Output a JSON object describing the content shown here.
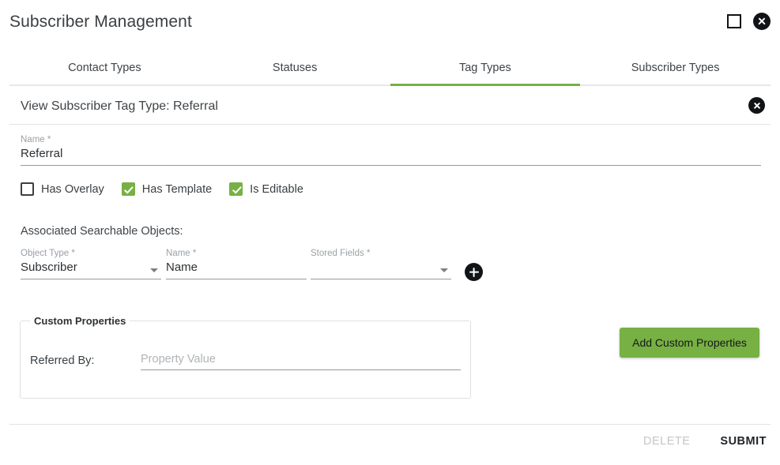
{
  "window": {
    "title": "Subscriber Management",
    "maximize_icon": "square-icon",
    "close_icon": "close-circle-icon"
  },
  "tabs": [
    {
      "label": "Contact Types",
      "active": false
    },
    {
      "label": "Statuses",
      "active": false
    },
    {
      "label": "Tag Types",
      "active": true
    },
    {
      "label": "Subscriber Types",
      "active": false
    }
  ],
  "section": {
    "title": "View Subscriber Tag Type: Referral",
    "close_icon": "close-circle-icon"
  },
  "name_field": {
    "label": "Name *",
    "value": "Referral"
  },
  "checkboxes": [
    {
      "label": "Has Overlay",
      "checked": false
    },
    {
      "label": "Has Template",
      "checked": true
    },
    {
      "label": "Is Editable",
      "checked": true
    }
  ],
  "associated": {
    "title": "Associated Searchable Objects:",
    "object_type": {
      "label": "Object Type *",
      "value": "Subscriber"
    },
    "name": {
      "label": "Name *",
      "value": "Name"
    },
    "stored_fields": {
      "label": "Stored Fields *",
      "value": ""
    },
    "add_icon": "plus-circle-icon"
  },
  "custom_properties": {
    "legend": "Custom Properties",
    "property_label": "Referred By:",
    "property_placeholder": "Property Value",
    "add_button_label": "Add Custom Properties"
  },
  "footer": {
    "delete_label": "DELETE",
    "submit_label": "SUBMIT"
  },
  "colors": {
    "accent_green": "#77b043",
    "text_dark": "#3f4448",
    "text_muted": "#9aa0a6",
    "disabled": "#c3c6c9"
  }
}
